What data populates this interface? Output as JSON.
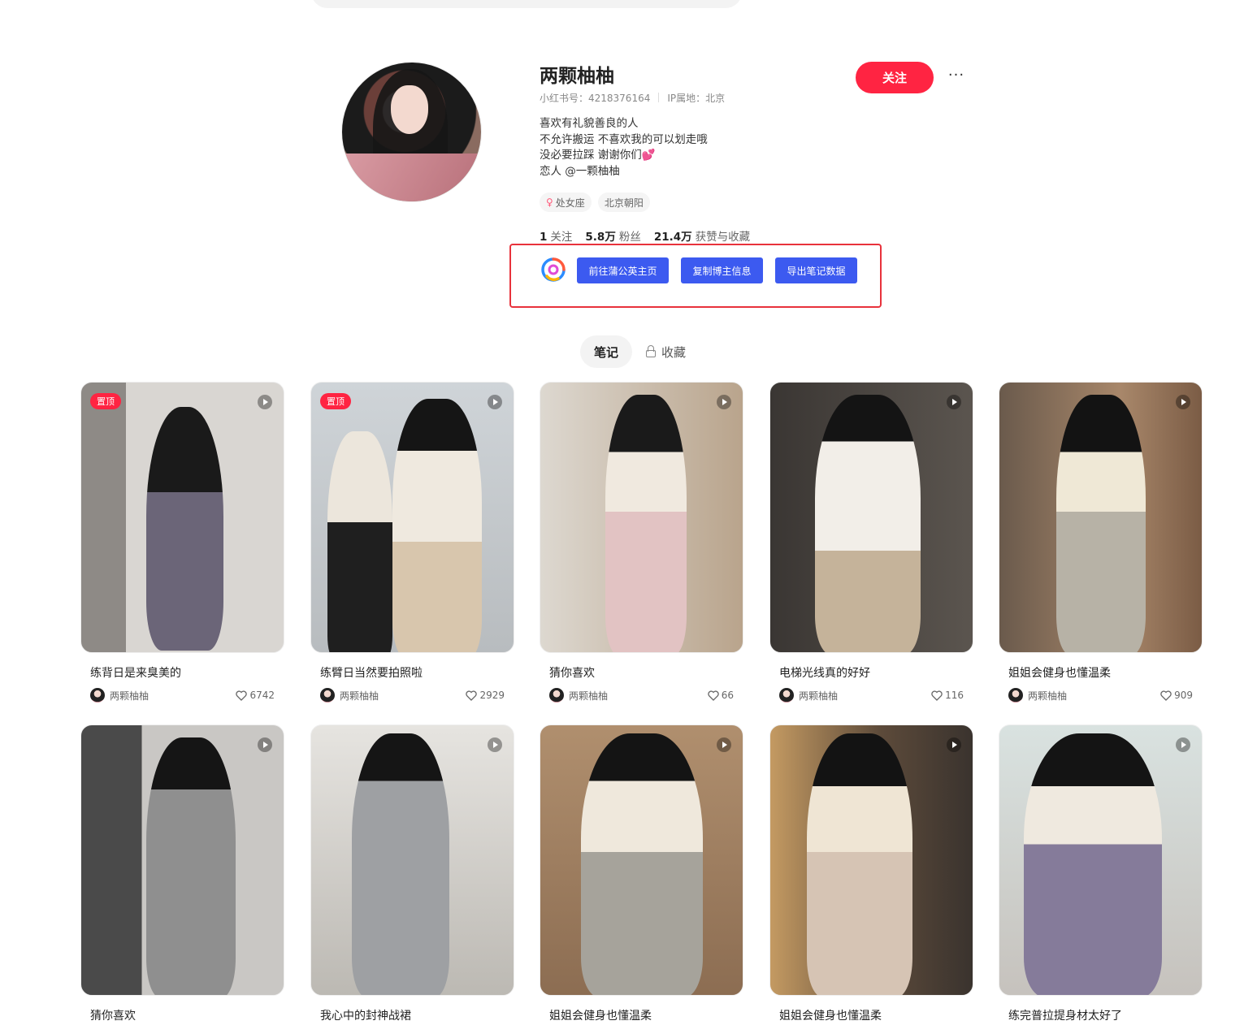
{
  "profile": {
    "name": "两颗柚柚",
    "red_id": "小红书号：4218376164",
    "ip": "IP属地：北京",
    "bio": [
      "喜欢有礼貌善良的人",
      "不允许搬运 不喜欢我的可以划走哦",
      "没必要拉踩 谢谢你们💕",
      "恋人 @一颗柚柚"
    ],
    "tags": [
      "处女座",
      "北京朝阳"
    ],
    "stats": {
      "following": {
        "value": "1",
        "label": "关注"
      },
      "fans": {
        "value": "5.8万",
        "label": "粉丝"
      },
      "likes": {
        "value": "21.4万",
        "label": "获赞与收藏"
      }
    },
    "follow_label": "关注",
    "more_label": "···"
  },
  "plugin": {
    "buttons": [
      "前往蒲公英主页",
      "复制博主信息",
      "导出笔记数据"
    ],
    "accent": "#3c5af0",
    "highlight_border": "#e8323c"
  },
  "tabs": {
    "notes": "笔记",
    "collections": "收藏"
  },
  "notes": [
    {
      "title": "练背日是来臭美的",
      "author": "两颗柚柚",
      "likes": "6742",
      "pinned": "置顶"
    },
    {
      "title": "练臂日当然要拍照啦",
      "author": "两颗柚柚",
      "likes": "2929",
      "pinned": "置顶"
    },
    {
      "title": "猜你喜欢",
      "author": "两颗柚柚",
      "likes": "66"
    },
    {
      "title": "电梯光线真的好好",
      "author": "两颗柚柚",
      "likes": "116"
    },
    {
      "title": "姐姐会健身也懂温柔",
      "author": "两颗柚柚",
      "likes": "909"
    },
    {
      "title": "猜你喜欢"
    },
    {
      "title": "我心中的封神战裙"
    },
    {
      "title": "姐姐会健身也懂温柔"
    },
    {
      "title": "姐姐会健身也懂温柔"
    },
    {
      "title": "练完普拉提身材太好了"
    }
  ],
  "colors": {
    "brand_red": "#ff2442"
  }
}
